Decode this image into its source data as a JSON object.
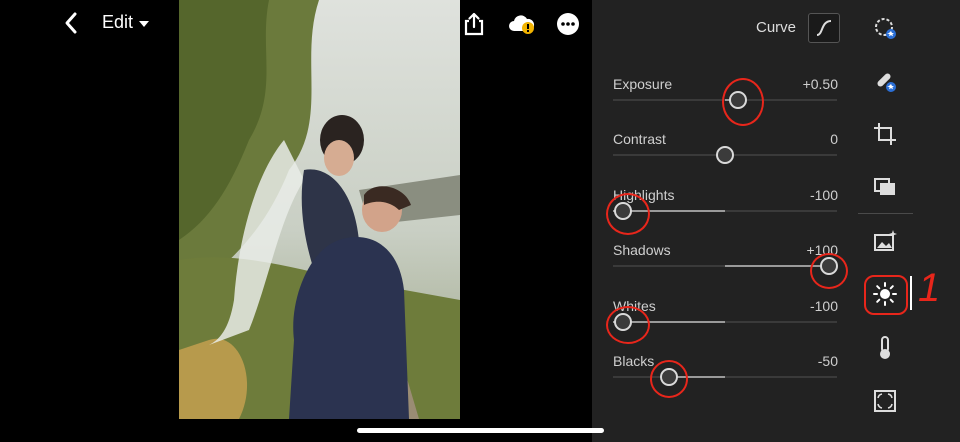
{
  "header": {
    "edit_label": "Edit",
    "icons": [
      "back-chevron-icon",
      "undo-icon",
      "share-icon",
      "cloud-sync-warning-icon",
      "more-icon"
    ]
  },
  "photo": {
    "description_icon": "photo"
  },
  "panel": {
    "curve_label": "Curve",
    "rows": [
      {
        "label": "Exposure",
        "value": "+0.50",
        "level": 0.56
      },
      {
        "label": "Contrast",
        "value": "0",
        "level": 0.5
      },
      {
        "label": "Highlights",
        "value": "-100",
        "level": 0.0
      },
      {
        "label": "Shadows",
        "value": "+100",
        "level": 1.0
      },
      {
        "label": "Whites",
        "value": "-100",
        "level": 0.0
      },
      {
        "label": "Blacks",
        "value": "-50",
        "level": 0.25
      }
    ]
  },
  "toolbar": {
    "icons": [
      "healing-brush-icon",
      "selective-brush-icon",
      "crop-icon",
      "presets-icon",
      "auto-icon",
      "light-icon",
      "color-temperature-icon",
      "vignette-icon"
    ],
    "active": "light-icon"
  },
  "annotation": {
    "mark": "1"
  },
  "colors": {
    "panel_bg": "#222222",
    "annotation_red": "#e8261b",
    "thumb_border": "#d9d9d9"
  }
}
